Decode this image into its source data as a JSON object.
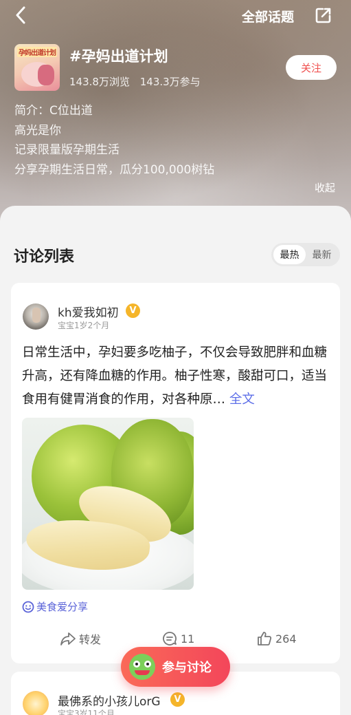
{
  "nav": {
    "back_icon": "chevron-left-icon",
    "all_topics": "全部话题",
    "share_icon": "share-icon"
  },
  "topic": {
    "thumb_text": "孕妈出道计划",
    "title": "#孕妈出道计划",
    "views": "143.8万浏览",
    "participants": "143.3万参与",
    "follow_label": "关注",
    "intro_lines": [
      "简介：C位出道",
      "高光是你",
      "记录限量版孕期生活",
      "分享孕期生活日常，瓜分100,000树钻"
    ],
    "collapse_label": "收起"
  },
  "discussion": {
    "title": "讨论列表",
    "sort_options": [
      "最热",
      "最新"
    ],
    "active_sort": "最热"
  },
  "posts": [
    {
      "username": "kh爱我如初",
      "verified_badge": "V",
      "baby_age": "宝宝1岁2个月",
      "text": "日常生活中，孕妇要多吃柚子，不仅会导致肥胖和血糖升高，还有降血糖的作用。柚子性寒，酸甜可口，适当食用有健胃消食的作用，对各种原…",
      "more_label": "全文",
      "tag": "美食爱分享",
      "actions": {
        "share_label": "转发",
        "comment_count": "11",
        "like_count": "264"
      }
    },
    {
      "username": "最佛系的小孩儿orG",
      "verified_badge": "V",
      "baby_age": "宝宝3岁11个月"
    }
  ],
  "fab": {
    "label": "参与讨论"
  },
  "colors": {
    "accent_red": "#f0504f",
    "link_blue": "#5e6fe8",
    "badge_gold": "#f5b52a"
  }
}
